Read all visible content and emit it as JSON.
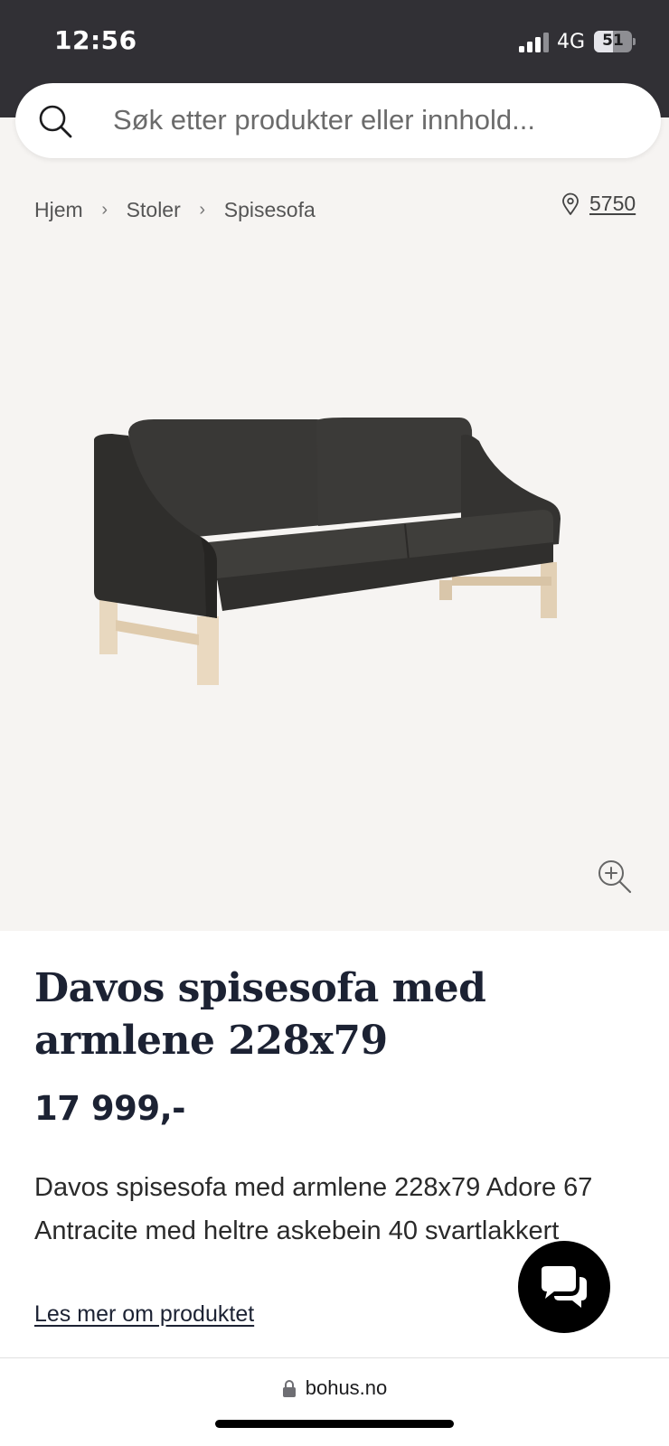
{
  "status_bar": {
    "time": "12:56",
    "network": "4G",
    "battery_level": "51",
    "battery_fraction": 0.51
  },
  "search": {
    "placeholder": "Søk etter produkter eller innhold..."
  },
  "breadcrumb": {
    "items": [
      "Hjem",
      "Stoler",
      "Spisesofa"
    ]
  },
  "store": {
    "label": "5750",
    "icon": "location-pin-icon"
  },
  "product": {
    "title": "Davos spisesofa med armlene 228x79",
    "price": "17 999,-",
    "description": "Davos spisesofa med armlene 228x79 Adore 67 Antracite med heltre askebein 40 svartlakkert",
    "read_more": "Les mer om produktet"
  },
  "browser": {
    "url": "bohus.no"
  },
  "colors": {
    "status_bar_bg": "#313035",
    "hero_bg": "#f6f4f2",
    "title": "#1c2233",
    "sofa_fabric": "#3a3937",
    "sofa_legs": "#e6d5bc",
    "chat_button": "#000000"
  },
  "icons": {
    "search": "search-icon",
    "zoom": "zoom-in-icon",
    "chat": "chat-bubbles-icon",
    "lock": "lock-icon"
  }
}
